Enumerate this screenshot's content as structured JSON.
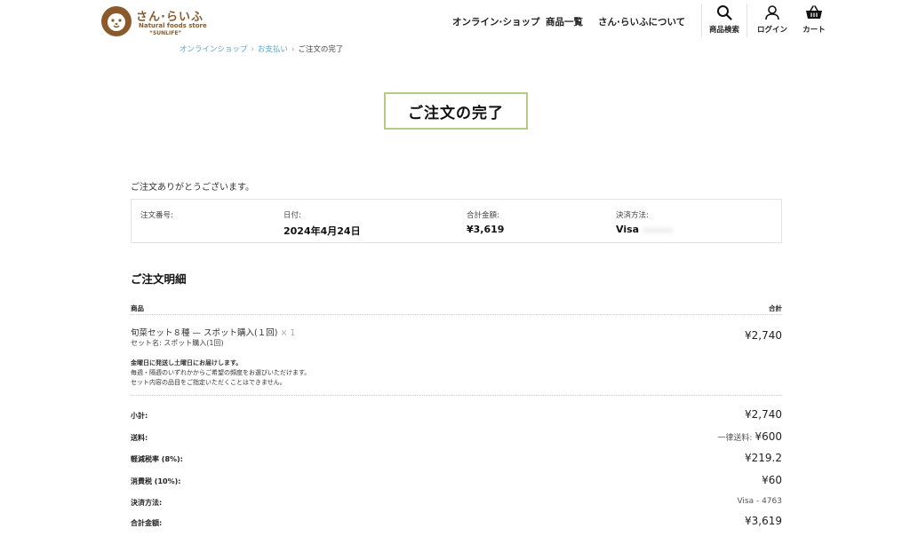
{
  "header": {
    "logo": {
      "title": "さん·らいふ",
      "subtitle": "Natural foods store",
      "tagline": "“SUNLIFE”"
    },
    "nav": [
      "オンライン·ショップ",
      "商品一覧",
      "さん·らいふについて"
    ],
    "icons": [
      {
        "icon": "search-icon",
        "label": "商品検索"
      },
      {
        "icon": "user-icon",
        "label": "ログイン"
      },
      {
        "icon": "cart-icon",
        "label": "カート"
      }
    ]
  },
  "breadcrumb": {
    "items": [
      "オンラインショップ",
      "お支払い"
    ],
    "current": "ご注文の完了",
    "separator": "›"
  },
  "page_title": "ご注文の完了",
  "thanks": "ご注文ありがとうございます。",
  "overview": [
    {
      "label": "注文番号:",
      "value": ""
    },
    {
      "label": "日付:",
      "value": "2024年4月24日"
    },
    {
      "label": "合計金額:",
      "value": "¥3,619"
    },
    {
      "label": "決済方法:",
      "value": "Visa"
    }
  ],
  "details": {
    "title": "ご注文明細",
    "col_product": "商品",
    "col_total": "合計",
    "item": {
      "name": "旬菜セット８種 — スポット購入(１回)",
      "qty": "× 1",
      "set_name": "セット名:  スポット購入(1回)",
      "price": "¥2,740"
    },
    "notes": [
      "金曜日に発送し土曜日にお届けします。",
      "毎週・隔週のいずれかからご希望の頻度をお選びいただけます。",
      "セット内容の品目をご指定いただくことはできません。"
    ],
    "summary": [
      {
        "label": "小計:",
        "value": "¥2,740"
      },
      {
        "label": "送料:",
        "prefix": "一律送料:",
        "value": "¥600"
      },
      {
        "label": "軽減税率 (8%):",
        "value": "¥219.2"
      },
      {
        "label": "消費税 (10%):",
        "value": "¥60"
      },
      {
        "label": "決済方法:",
        "value": "Visa - 4763"
      },
      {
        "label": "合計金額:",
        "value": "¥3,619"
      }
    ]
  },
  "colors": {
    "brand": "#8b5a2b",
    "link": "#5aa6c8",
    "title_border": "#b3cb82"
  }
}
